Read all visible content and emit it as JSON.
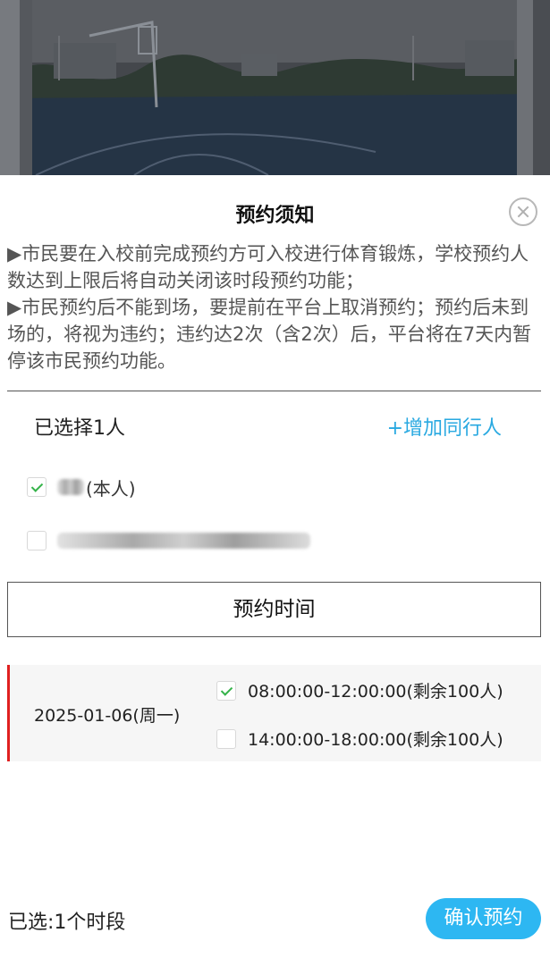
{
  "notice": {
    "title": "预约须知",
    "paragraph1": "▶市民要在入校前完成预约方可入校进行体育锻炼，学校预约人数达到上限后将自动关闭该时段预约功能；",
    "paragraph2": "▶市民预约后不能到场，要提前在平台上取消预约；预约后未到场的，将视为违约；违约达2次（含2次）后，平台将在7天内暂停该市民预约功能。"
  },
  "companions": {
    "selected_count": "已选择1人",
    "add_label": "+增加同行人",
    "persons": [
      {
        "label": "(本人)",
        "checked": true
      },
      {
        "label": "",
        "checked": false
      }
    ]
  },
  "time_section": {
    "button_label": "预约时间",
    "date": "2025-01-06(周一)",
    "slots": [
      {
        "label": "08:00:00-12:00:00(剩余100人)",
        "checked": true
      },
      {
        "label": "14:00:00-18:00:00(剩余100人)",
        "checked": false
      }
    ]
  },
  "footer": {
    "selected_slots": "已选:1个时段",
    "confirm_label": "确认预约"
  },
  "colors": {
    "accent_link": "#29a9e1",
    "confirm_button": "#2db7f2",
    "date_marker": "#e02020",
    "check_mark": "#35b34a"
  }
}
